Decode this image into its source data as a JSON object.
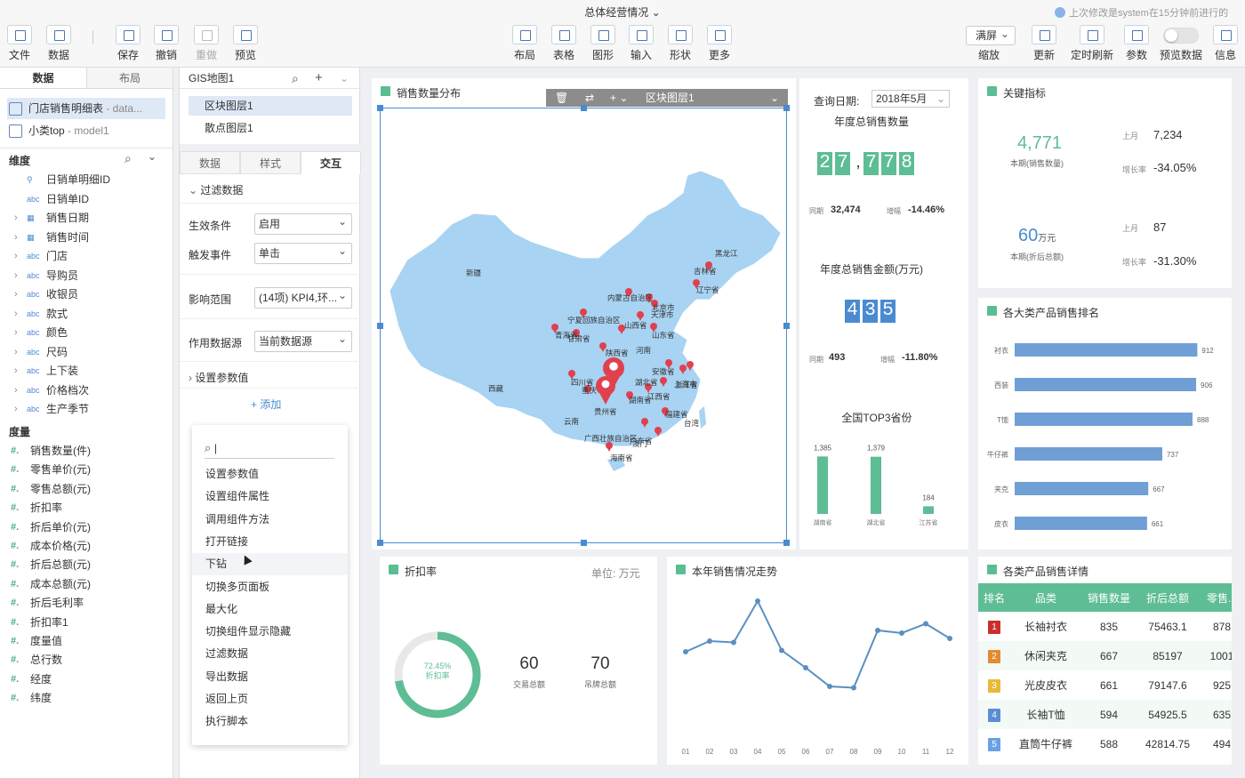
{
  "header": {
    "title": "总体经营情况",
    "last_modified": "上次修改是system在15分钟前进行的",
    "left_tools": [
      {
        "label": "文件",
        "disabled": false
      },
      {
        "label": "数据",
        "disabled": false
      },
      {
        "label": "保存",
        "disabled": false
      },
      {
        "label": "撤销",
        "disabled": false
      },
      {
        "label": "重做",
        "disabled": true
      },
      {
        "label": "预览",
        "disabled": false
      }
    ],
    "mid_tools": [
      "布局",
      "表格",
      "图形",
      "输入",
      "形状",
      "更多"
    ],
    "zoom_value": "满屏",
    "zoom_label": "缩放",
    "right_tools": [
      "更新",
      "定时刷新",
      "参数",
      "预览数据",
      "信息"
    ]
  },
  "left_panel": {
    "tabs": [
      "数据",
      "布局"
    ],
    "datasets": [
      {
        "name": "门店销售明细表",
        "suffix": " - data..."
      },
      {
        "name": "小类top",
        "suffix": " - model1"
      }
    ],
    "dim_title": "维度",
    "dimensions": [
      {
        "name": "日销单明细ID",
        "type": "geo",
        "expand": false
      },
      {
        "name": "日销单ID",
        "type": "abc",
        "expand": false
      },
      {
        "name": "销售日期",
        "type": "date",
        "expand": true
      },
      {
        "name": "销售时间",
        "type": "date",
        "expand": true
      },
      {
        "name": "门店",
        "type": "abc",
        "expand": true
      },
      {
        "name": "导购员",
        "type": "abc",
        "expand": true
      },
      {
        "name": "收银员",
        "type": "abc",
        "expand": true
      },
      {
        "name": "款式",
        "type": "abc",
        "expand": true
      },
      {
        "name": "颜色",
        "type": "abc",
        "expand": true
      },
      {
        "name": "尺码",
        "type": "abc",
        "expand": true
      },
      {
        "name": "上下装",
        "type": "abc",
        "expand": true
      },
      {
        "name": "价格档次",
        "type": "abc",
        "expand": true
      },
      {
        "name": "生产季节",
        "type": "abc",
        "expand": true
      }
    ],
    "measure_title": "度量",
    "measures": [
      "销售数量(件)",
      "零售单价(元)",
      "零售总额(元)",
      "折扣率",
      "折后单价(元)",
      "成本价格(元)",
      "折后总额(元)",
      "成本总额(元)",
      "折后毛利率",
      "折扣率1",
      "度量值",
      "总行数",
      "经度",
      "纬度"
    ]
  },
  "mid_panel": {
    "header": "GIS地图1",
    "layers": [
      "区块图层1",
      "散点图层1"
    ],
    "tabs": [
      "数据",
      "样式",
      "交互"
    ],
    "filter_section": "过滤数据",
    "rows": [
      {
        "label": "生效条件",
        "value": "启用"
      },
      {
        "label": "触发事件",
        "value": "单击"
      },
      {
        "label": "影响范围",
        "value": "(14项) KPI4,环..."
      },
      {
        "label": "作用数据源",
        "value": "当前数据源"
      }
    ],
    "param_section": "设置参数值",
    "add_label": "添加",
    "menu_search": "|",
    "menu_items": [
      "设置参数值",
      "设置组件属性",
      "调用组件方法",
      "打开链接",
      "下钻",
      "切换多页面板",
      "最大化",
      "切换组件显示隐藏",
      "过滤数据",
      "导出数据",
      "返回上页",
      "执行脚本"
    ],
    "menu_highlight": "下钻"
  },
  "map_card": {
    "title": "销售数量分布",
    "toolbar_layer": "区块图层1",
    "regions": [
      "黑龙江",
      "吉林省",
      "辽宁省",
      "内蒙古自治区",
      "北京市",
      "天津市",
      "山西省",
      "宁夏回族自治区",
      "青海省",
      "甘肃省",
      "陕西省",
      "河南",
      "山东省",
      "新疆",
      "西藏",
      "四川省",
      "重庆",
      "湖北省",
      "安徽省",
      "上海市",
      "浙江省",
      "江西省",
      "湖南省",
      "贵州省",
      "云南",
      "福建省",
      "台湾",
      "广西壮族自治区",
      "广东省",
      "澳门",
      "海南省"
    ]
  },
  "kpi_middle": {
    "query_label": "查询日期:",
    "query_value": "2018年5月",
    "sales_title": "年度总销售数量",
    "sales_digits": [
      "2",
      "7",
      ",",
      "7",
      "7",
      "8"
    ],
    "sales_prev_label": "同期",
    "sales_prev": "32,474",
    "sales_growth_label": "增幅",
    "sales_growth": "-14.46%",
    "amount_title": "年度总销售金额(万元)",
    "amount_digits": [
      "4",
      "3",
      "5"
    ],
    "amount_prev_label": "同期",
    "amount_prev": "493",
    "amount_growth_label": "增幅",
    "amount_growth": "-11.80%",
    "top3_title": "全国TOP3省份"
  },
  "top3_chart": {
    "chart_data": {
      "type": "bar",
      "categories": [
        "湖南省",
        "湖北省",
        "江苏省"
      ],
      "values": [
        1385,
        1379,
        184
      ],
      "value_labels": [
        "1,385",
        "1,379",
        "184"
      ],
      "ylim": [
        0,
        1500
      ],
      "grid": false
    }
  },
  "key_metrics": {
    "title": "关键指标",
    "m1_value": "4,771",
    "m1_label": "本期(销售数量)",
    "m1_prev_label": "上月",
    "m1_prev": "7,234",
    "m1_growth_label": "增长率",
    "m1_growth": "-34.05%",
    "m2_value": "60",
    "m2_unit": "万元",
    "m2_label": "本期(折后总额)",
    "m2_prev_label": "上月",
    "m2_prev": "87",
    "m2_growth_label": "增长率",
    "m2_growth": "-31.30%"
  },
  "rank_card": {
    "title": "各大类产品销售排名",
    "chart_data": {
      "type": "bar",
      "orientation": "horizontal",
      "categories": [
        "衬衣",
        "西装",
        "T恤",
        "牛仔裤",
        "夹克",
        "皮衣"
      ],
      "values": [
        912,
        906,
        888,
        737,
        667,
        661
      ],
      "xlim": [
        0,
        1000
      ],
      "grid": false
    }
  },
  "discount_card": {
    "title": "折扣率",
    "unit": "单位: 万元",
    "ring_value": "72.45%",
    "ring_label": "折扣率",
    "ring_fraction": 0.7245,
    "stat1_value": "60",
    "stat1_label": "交易总额",
    "stat2_value": "70",
    "stat2_label": "吊牌总额"
  },
  "trend_card": {
    "title": "本年销售情况走势",
    "chart_data": {
      "type": "line",
      "x": [
        "01",
        "02",
        "03",
        "04",
        "05",
        "06",
        "07",
        "08",
        "09",
        "10",
        "11",
        "12"
      ],
      "values": [
        54,
        62,
        61,
        92,
        55,
        42,
        28,
        27,
        70,
        68,
        75,
        64
      ],
      "ylim": [
        0,
        100
      ],
      "grid": false
    }
  },
  "detail_card": {
    "title": "各类产品销售详情",
    "columns": [
      "排名",
      "品类",
      "销售数量",
      "折后总额",
      "零售..."
    ],
    "rows": [
      {
        "rank": "1",
        "name": "长袖衬衣",
        "qty": "835",
        "amount": "75463.1",
        "retail": "878",
        "color": "#c9302c"
      },
      {
        "rank": "2",
        "name": "休闲夹克",
        "qty": "667",
        "amount": "85197",
        "retail": "1001",
        "color": "#e38b2f"
      },
      {
        "rank": "3",
        "name": "光皮皮衣",
        "qty": "661",
        "amount": "79147.6",
        "retail": "925",
        "color": "#e8b93a"
      },
      {
        "rank": "4",
        "name": "长袖T恤",
        "qty": "594",
        "amount": "54925.5",
        "retail": "635",
        "color": "#5b8dd6"
      },
      {
        "rank": "5",
        "name": "直筒牛仔裤",
        "qty": "588",
        "amount": "42814.75",
        "retail": "494",
        "color": "#6aa0e6"
      }
    ]
  },
  "colors": {
    "accent_green": "#5ebd94",
    "accent_blue": "#4a8bd0",
    "bar_blue": "#6f9fd4",
    "map_blue": "#a8d3f3",
    "pin_red": "#e0414e"
  }
}
